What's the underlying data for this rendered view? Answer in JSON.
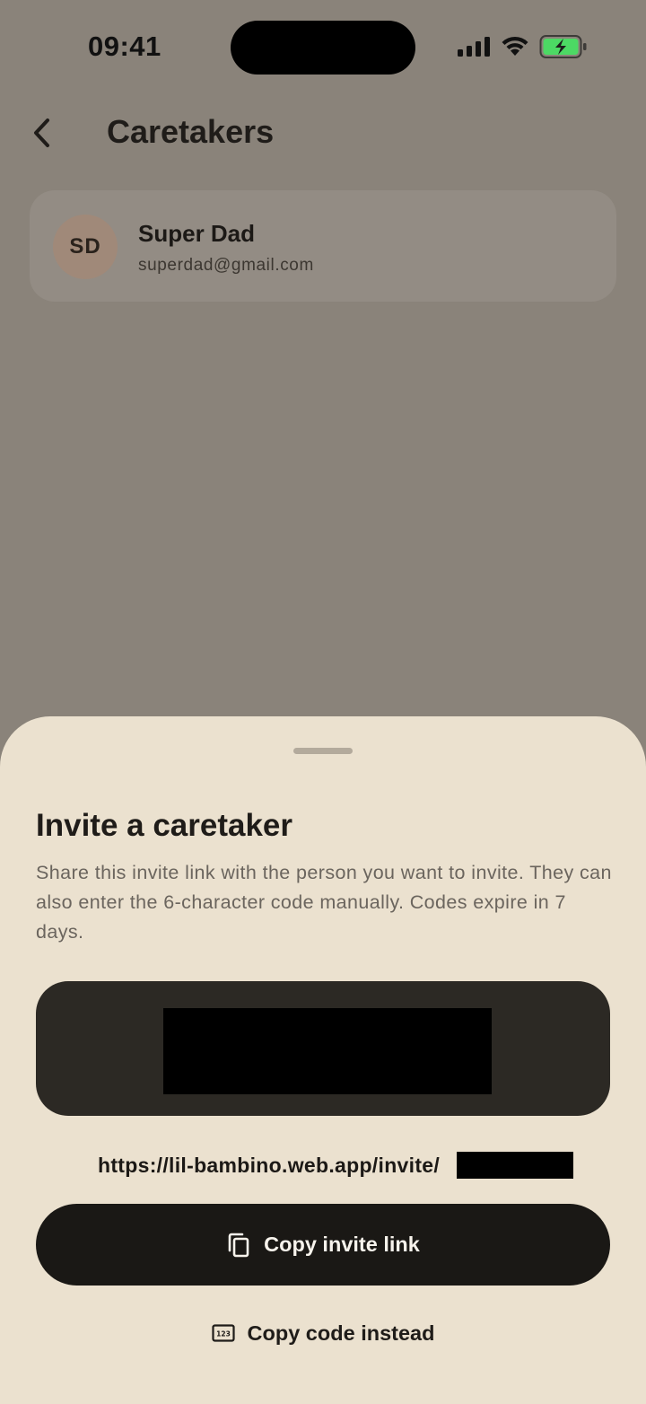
{
  "status_bar": {
    "time": "09:41",
    "battery_color": "#4cd964"
  },
  "header": {
    "title": "Caretakers",
    "back_icon": "chevron-left-icon"
  },
  "caretakers": [
    {
      "initials": "SD",
      "name": "Super Dad",
      "email": "superdad@gmail.com"
    }
  ],
  "invite_sheet": {
    "title": "Invite a caretaker",
    "description": "Share this invite link with the person you want to invite. They can also enter the 6-character code manually. Codes expire in 7 days.",
    "invite_link_prefix": "https://lil-bambino.web.app/invite/",
    "copy_link_label": "Copy invite link",
    "copy_link_icon": "copy-icon",
    "copy_code_label": "Copy code instead",
    "copy_code_icon": "numeric-code-icon"
  },
  "colors": {
    "overlay_background": "#8a837a",
    "sheet_background": "#ebe1cf",
    "primary_button": "#1a1815",
    "code_box": "#2c2924"
  }
}
